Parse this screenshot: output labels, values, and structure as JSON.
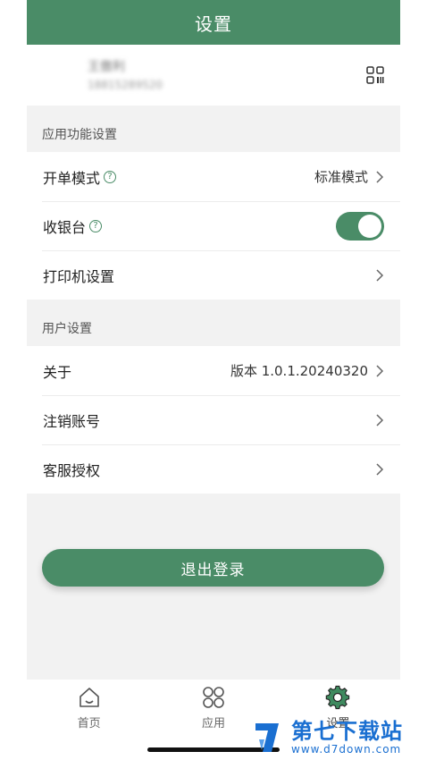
{
  "header": {
    "title": "设置"
  },
  "profile": {
    "name": "王傲利",
    "phone": "18815289520",
    "qr_icon": "qr-code-icon"
  },
  "sections": {
    "app": {
      "title": "应用功能设置",
      "rows": {
        "order_mode": {
          "label": "开单模式",
          "value": "标准模式"
        },
        "cashier": {
          "label": "收银台",
          "enabled": true
        },
        "printer": {
          "label": "打印机设置"
        }
      }
    },
    "user": {
      "title": "用户设置",
      "rows": {
        "about": {
          "label": "关于",
          "value": "版本 1.0.1.20240320"
        },
        "deregister": {
          "label": "注销账号"
        },
        "support": {
          "label": "客服授权"
        }
      }
    }
  },
  "logout": {
    "label": "退出登录"
  },
  "tabbar": {
    "home": {
      "label": "首页",
      "icon": "home-icon"
    },
    "apps": {
      "label": "应用",
      "icon": "apps-grid-icon"
    },
    "settings": {
      "label": "设置",
      "icon": "gear-icon"
    }
  },
  "watermark": {
    "name": "第七下载站",
    "url": "www.d7down.com"
  },
  "colors": {
    "accent": "#4a8c67",
    "background": "#f2f2f2"
  }
}
